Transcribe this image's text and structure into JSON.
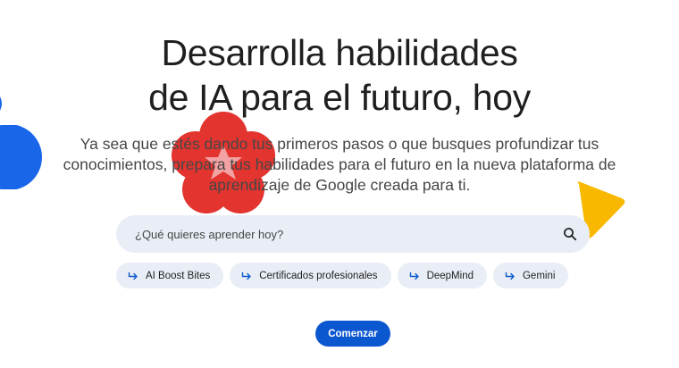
{
  "hero": {
    "headline_line1": "Desarrolla habilidades",
    "headline_line2": "de IA para el futuro, hoy",
    "subtitle": "Ya sea que estés dando tus primeros pasos o que busques profundizar tus conocimientos, prepara tus habilidades para el futuro en la nueva plataforma de aprendizaje de Google creada para ti."
  },
  "search": {
    "placeholder": "¿Qué quieres aprender hoy?",
    "value": "",
    "icon": "search-icon"
  },
  "chips": [
    {
      "label": "AI Boost Bites",
      "icon": "arrow-icon"
    },
    {
      "label": "Certificados profesionales",
      "icon": "arrow-icon"
    },
    {
      "label": "DeepMind",
      "icon": "arrow-icon"
    },
    {
      "label": "Gemini",
      "icon": "arrow-icon"
    }
  ],
  "cta": {
    "label": "Comenzar"
  },
  "colors": {
    "primary": "#0b57d0",
    "decor_blue": "#1a66ea",
    "decor_red": "#e3342f",
    "decor_pink": "#f2a2a2",
    "decor_yellow": "#f9b800",
    "surface": "#e9eef6"
  }
}
